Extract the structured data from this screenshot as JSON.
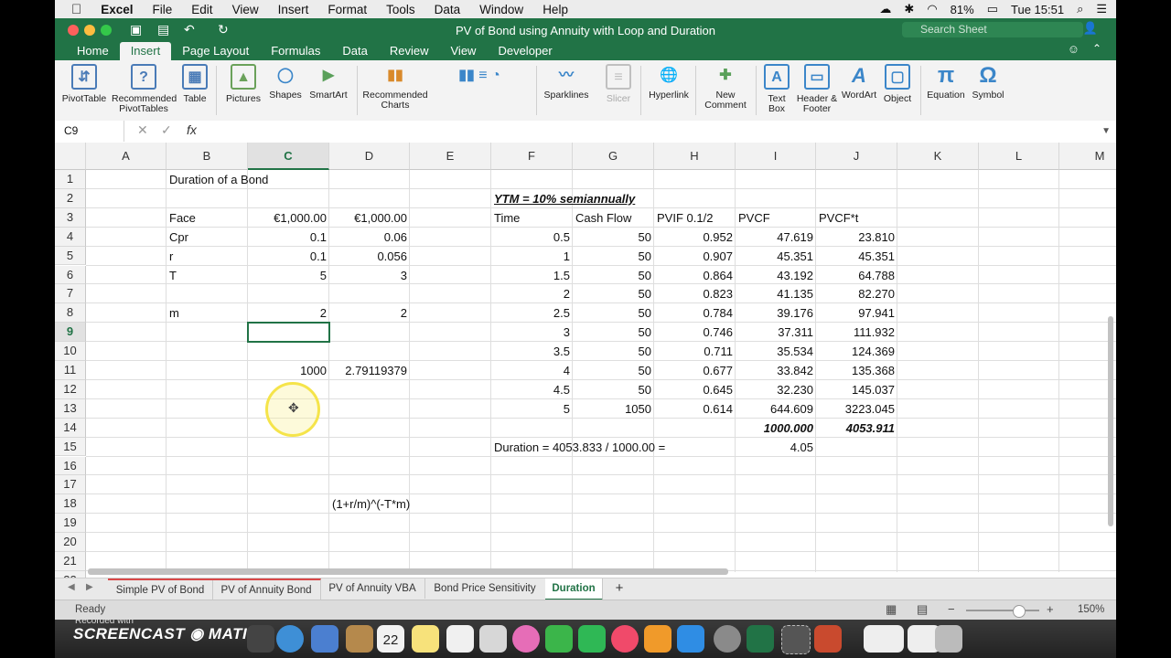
{
  "menubar": {
    "app": "Excel",
    "items": [
      "File",
      "Edit",
      "View",
      "Insert",
      "Format",
      "Tools",
      "Data",
      "Window",
      "Help"
    ],
    "battery": "81%",
    "clock": "Tue 15:51"
  },
  "window": {
    "title": "PV of Bond using Annuity with Loop and Duration",
    "search_placeholder": "Search Sheet"
  },
  "ribbon": {
    "tabs": [
      "Home",
      "Insert",
      "Page Layout",
      "Formulas",
      "Data",
      "Review",
      "View",
      "Developer"
    ],
    "active_tab": "Insert",
    "buttons": [
      {
        "label1": "PivotTable",
        "label2": "",
        "icon": "pivot-table-icon",
        "color": "#4a7bb7"
      },
      {
        "label1": "Recommended",
        "label2": "PivotTables",
        "icon": "recommended-pivot-icon",
        "color": "#4a7bb7"
      },
      {
        "label1": "Table",
        "label2": "",
        "icon": "table-icon",
        "color": "#4a7bb7"
      },
      {
        "label1": "Pictures",
        "label2": "",
        "icon": "pictures-icon",
        "color": "#6aa15a"
      },
      {
        "label1": "Shapes",
        "label2": "",
        "icon": "shapes-icon",
        "color": "#3b86c9"
      },
      {
        "label1": "SmartArt",
        "label2": "",
        "icon": "smartart-icon",
        "color": "#5aa05a"
      },
      {
        "label1": "Recommended",
        "label2": "Charts",
        "icon": "recommended-charts-icon",
        "color": "#d98a2b"
      },
      {
        "label1": "",
        "label2": "",
        "icon": "chart-types-icon",
        "color": "#3b86c9"
      },
      {
        "label1": "Sparklines",
        "label2": "",
        "icon": "sparklines-icon",
        "color": "#3b86c9"
      },
      {
        "label1": "Slicer",
        "label2": "",
        "icon": "slicer-icon",
        "color": "#b8b8b8"
      },
      {
        "label1": "Hyperlink",
        "label2": "",
        "icon": "hyperlink-icon",
        "color": "#3b86c9"
      },
      {
        "label1": "New",
        "label2": "Comment",
        "icon": "new-comment-icon",
        "color": "#5aa05a"
      },
      {
        "label1": "Text",
        "label2": "Box",
        "icon": "text-box-icon",
        "color": "#3b86c9"
      },
      {
        "label1": "Header &",
        "label2": "Footer",
        "icon": "header-footer-icon",
        "color": "#3b86c9"
      },
      {
        "label1": "WordArt",
        "label2": "",
        "icon": "wordart-icon",
        "color": "#3b86c9"
      },
      {
        "label1": "Object",
        "label2": "",
        "icon": "object-icon",
        "color": "#3b86c9"
      },
      {
        "label1": "Equation",
        "label2": "",
        "icon": "equation-icon",
        "color": "#3b86c9"
      },
      {
        "label1": "Symbol",
        "label2": "",
        "icon": "symbol-icon",
        "color": "#3b86c9"
      }
    ]
  },
  "formula_bar": {
    "name_box": "C9",
    "formula": ""
  },
  "grid": {
    "columns": [
      "A",
      "B",
      "C",
      "D",
      "E",
      "F",
      "G",
      "H",
      "I",
      "J",
      "K",
      "L",
      "M"
    ],
    "selected_column": "C",
    "rows": [
      "1",
      "2",
      "3",
      "4",
      "5",
      "6",
      "7",
      "8",
      "9",
      "10",
      "11",
      "12",
      "13",
      "14",
      "15",
      "16",
      "17",
      "18",
      "19",
      "20",
      "21",
      "22"
    ],
    "selected_row": "9",
    "cells": {
      "B1": "Duration of a Bond",
      "F2": "YTM = 10% semiannually",
      "B3": "Face",
      "C3": "€1,000.00",
      "D3": "€1,000.00",
      "F3": "Time",
      "G3": "Cash Flow",
      "H3": "PVIF  0.1/2",
      "I3": "PVCF",
      "J3": "PVCF*t",
      "B4": "Cpr",
      "C4": "0.1",
      "D4": "0.06",
      "F4": "0.5",
      "G4": "50",
      "H4": "0.952",
      "I4": "47.619",
      "J4": "23.810",
      "B5": "r",
      "C5": "0.1",
      "D5": "0.056",
      "F5": "1",
      "G5": "50",
      "H5": "0.907",
      "I5": "45.351",
      "J5": "45.351",
      "B6": "T",
      "C6": "5",
      "D6": "3",
      "F6": "1.5",
      "G6": "50",
      "H6": "0.864",
      "I6": "43.192",
      "J6": "64.788",
      "F7": "2",
      "G7": "50",
      "H7": "0.823",
      "I7": "41.135",
      "J7": "82.270",
      "B8": "m",
      "C8": "2",
      "D8": "2",
      "F8": "2.5",
      "G8": "50",
      "H8": "0.784",
      "I8": "39.176",
      "J8": "97.941",
      "F9": "3",
      "G9": "50",
      "H9": "0.746",
      "I9": "37.311",
      "J9": "111.932",
      "F10": "3.5",
      "G10": "50",
      "H10": "0.711",
      "I10": "35.534",
      "J10": "124.369",
      "C11": "1000",
      "D11": "2.79119379",
      "F11": "4",
      "G11": "50",
      "H11": "0.677",
      "I11": "33.842",
      "J11": "135.368",
      "F12": "4.5",
      "G12": "50",
      "H12": "0.645",
      "I12": "32.230",
      "J12": "145.037",
      "F13": "5",
      "G13": "1050",
      "H13": "0.614",
      "I13": "644.609",
      "J13": "3223.045",
      "I14": "1000.000",
      "J14": "4053.911",
      "F15": "Duration = 4053.833 / 1000.00 =",
      "I15": "4.05",
      "D18": "(1+r/m)^(-T*m)"
    }
  },
  "sheets": {
    "tabs": [
      "Simple PV of Bond",
      "PV of Annuity Bond",
      "PV of Annuity VBA",
      "Bond Price Sensitivity",
      "Duration"
    ],
    "active": "Duration",
    "add_label": "+"
  },
  "status": {
    "ready": "Ready",
    "zoom": "150%",
    "zoom_level_pct": 150
  },
  "dock": {
    "watermark": "SCREENCAST ◉ MATIC",
    "recorded": "Recorded with",
    "calendar_day": "22"
  },
  "colors": {
    "excel_green": "#217346",
    "selection": "#217346",
    "highlight_ring": "#f5e44a"
  }
}
